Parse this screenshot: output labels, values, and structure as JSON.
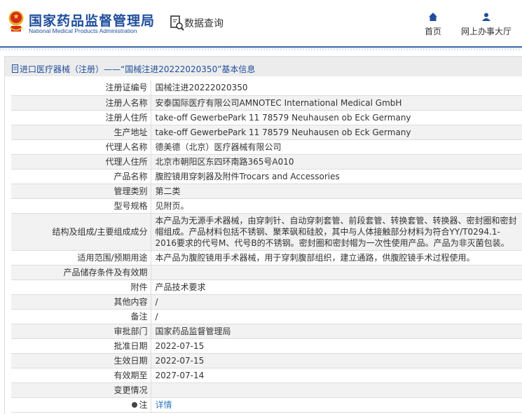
{
  "header": {
    "logo_cn": "国家药品监督管理局",
    "logo_en": "National Medical Products Administration",
    "query": "数据查询",
    "nav": [
      {
        "label": "首页",
        "icon": "home-icon"
      },
      {
        "label": "网上办事大厅",
        "icon": "user-icon"
      }
    ]
  },
  "title": "进口医疗器械（注册）——“国械注进20222020350”基本信息",
  "rows": [
    {
      "label": "注册证编号",
      "value": "国械注进20222020350"
    },
    {
      "label": "注册人名称",
      "value": "安泰国际医疗有限公司AMNOTEC International Medical GmbH"
    },
    {
      "label": "注册人住所",
      "value": "take-off GewerbePark 11 78579 Neuhausen ob Eck Germany"
    },
    {
      "label": "生产地址",
      "value": "take-off GewerbePark 11 78579 Neuhausen ob Eck Germany"
    },
    {
      "label": "代理人名称",
      "value": "德美德（北京）医疗器械有限公司"
    },
    {
      "label": "代理人住所",
      "value": "北京市朝阳区东四环南路365号A010"
    },
    {
      "label": "产品名称",
      "value": "腹腔镜用穿刺器及附件Trocars and Accessories"
    },
    {
      "label": "管理类别",
      "value": "第二类"
    },
    {
      "label": "型号规格",
      "value": "见附页。"
    },
    {
      "label": "结构及组成/主要组成成分",
      "value": "本产品为无源手术器械，由穿刺针、自动穿刺套管、前段套管、转换套管、转换器、密封圈和密封帽组成。产品材料包括不锈钢、聚苯砜和硅胶，其中与人体接触部分材料为符合YY/T0294.1-2016要求的代号M、代号B的不锈钢。密封圈和密封帽为一次性使用产品。产品为非灭菌包装。"
    },
    {
      "label": "适用范围/预期用途",
      "value": "本产品为腹腔镜用手术器械，用于穿刺腹部组织，建立通路，供腹腔镜手术过程使用。"
    },
    {
      "label": "产品储存条件及有效期",
      "value": ""
    },
    {
      "label": "附件",
      "value": "产品技术要求"
    },
    {
      "label": "其他内容",
      "value": "/"
    },
    {
      "label": "备注",
      "value": "/"
    },
    {
      "label": "审批部门",
      "value": "国家药品监督管理局"
    },
    {
      "label": "批准日期",
      "value": "2022-07-15"
    },
    {
      "label": "生效日期",
      "value": "2022-07-15"
    },
    {
      "label": "有效期至",
      "value": "2027-07-14"
    },
    {
      "label": "变更情况",
      "value": ""
    }
  ],
  "note": {
    "label": "注",
    "link": "详情"
  }
}
